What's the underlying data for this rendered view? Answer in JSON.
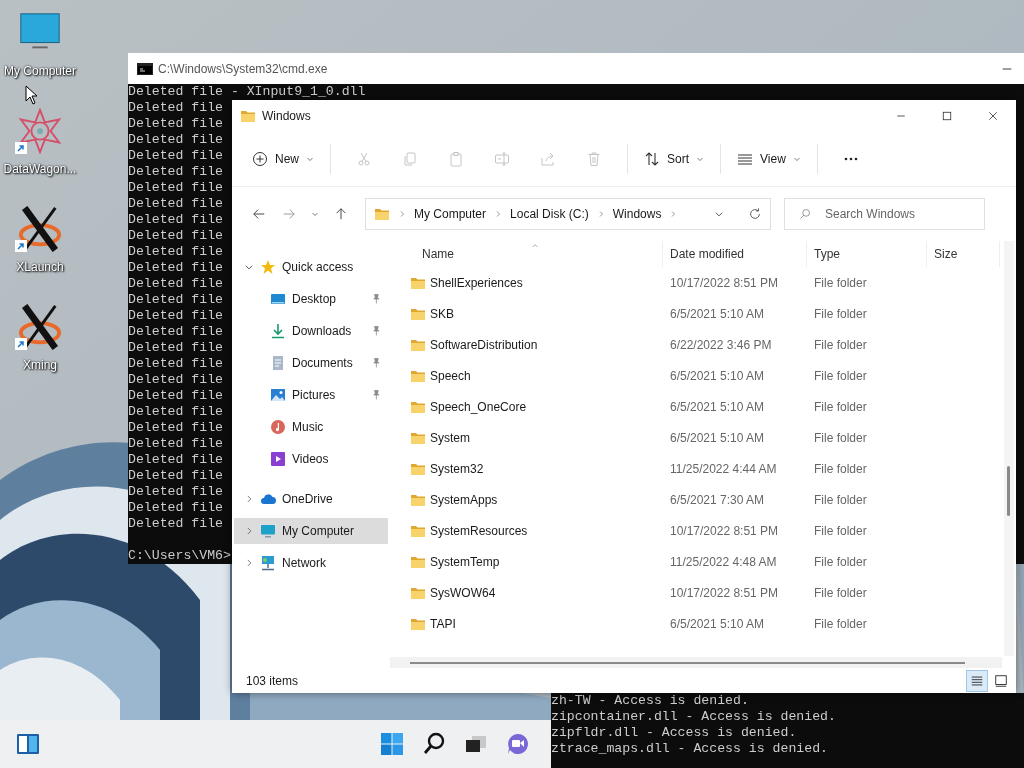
{
  "desktop_icons": [
    {
      "label": "My Computer",
      "shortcut": false
    },
    {
      "label": "DataWagon...",
      "shortcut": true
    },
    {
      "label": "XLaunch",
      "shortcut": true
    },
    {
      "label": "Xming",
      "shortcut": true
    }
  ],
  "console_window": {
    "title": "C:\\Windows\\System32\\cmd.exe",
    "lines": [
      "Deleted file - XInput9_1_0.dll",
      "Deleted file",
      "Deleted file",
      "Deleted file",
      "Deleted file",
      "Deleted file",
      "Deleted file",
      "Deleted file",
      "Deleted file",
      "Deleted file",
      "Deleted file",
      "Deleted file",
      "Deleted file",
      "Deleted file",
      "Deleted file",
      "Deleted file",
      "Deleted file",
      "Deleted file",
      "Deleted file",
      "Deleted file",
      "Deleted file",
      "Deleted file",
      "Deleted file",
      "Deleted file",
      "Deleted file",
      "Deleted file",
      "Deleted file",
      "Deleted file"
    ],
    "prompt": "C:\\Users\\VM6>"
  },
  "background_console": {
    "lines": [
      "zh-TW - Access is denied.",
      "zipcontainer.dll - Access is denied.",
      "zipfldr.dll - Access is denied.",
      "ztrace_maps.dll - Access is denied."
    ]
  },
  "explorer_window": {
    "title": "Windows",
    "toolbar": {
      "new_label": "New",
      "sort_label": "Sort",
      "view_label": "View",
      "actions": [
        {
          "disabled": true
        },
        {
          "disabled": true
        },
        {
          "disabled": true
        },
        {
          "disabled": true
        },
        {
          "disabled": true
        },
        {
          "disabled": true
        }
      ]
    },
    "address": {
      "path": [
        "My Computer",
        "Local Disk (C:)",
        "Windows"
      ]
    },
    "search": {
      "placeholder": "Search Windows"
    },
    "navigation": [
      {
        "label": "Quick access",
        "expanded": true,
        "selected": false,
        "children": [
          {
            "label": "Desktop",
            "pinned": true
          },
          {
            "label": "Downloads",
            "pinned": true
          },
          {
            "label": "Documents",
            "pinned": true
          },
          {
            "label": "Pictures",
            "pinned": true
          },
          {
            "label": "Music",
            "pinned": false
          },
          {
            "label": "Videos",
            "pinned": false
          }
        ]
      },
      {
        "label": "OneDrive",
        "expanded": false,
        "selected": false
      },
      {
        "label": "My Computer",
        "expanded": false,
        "selected": true
      },
      {
        "label": "Network",
        "expanded": false,
        "selected": false
      }
    ],
    "columns": [
      {
        "label": "Name",
        "sorted": true
      },
      {
        "label": "Date modified",
        "sorted": false
      },
      {
        "label": "Type",
        "sorted": false
      },
      {
        "label": "Size",
        "sorted": false
      }
    ],
    "rows": [
      {
        "name": "ShellExperiences",
        "date": "10/17/2022 8:51 PM",
        "type": "File folder"
      },
      {
        "name": "SKB",
        "date": "6/5/2021 5:10 AM",
        "type": "File folder"
      },
      {
        "name": "SoftwareDistribution",
        "date": "6/22/2022 3:46 PM",
        "type": "File folder"
      },
      {
        "name": "Speech",
        "date": "6/5/2021 5:10 AM",
        "type": "File folder"
      },
      {
        "name": "Speech_OneCore",
        "date": "6/5/2021 5:10 AM",
        "type": "File folder"
      },
      {
        "name": "System",
        "date": "6/5/2021 5:10 AM",
        "type": "File folder"
      },
      {
        "name": "System32",
        "date": "11/25/2022 4:44 AM",
        "type": "File folder"
      },
      {
        "name": "SystemApps",
        "date": "6/5/2021 7:30 AM",
        "type": "File folder"
      },
      {
        "name": "SystemResources",
        "date": "10/17/2022 8:51 PM",
        "type": "File folder"
      },
      {
        "name": "SystemTemp",
        "date": "11/25/2022 4:48 AM",
        "type": "File folder"
      },
      {
        "name": "SysWOW64",
        "date": "10/17/2022 8:51 PM",
        "type": "File folder"
      },
      {
        "name": "TAPI",
        "date": "6/5/2021 5:10 AM",
        "type": "File folder"
      }
    ],
    "status_bar": {
      "item_count": "103 items"
    },
    "view_modes": [
      {
        "selected": true
      },
      {
        "selected": false
      }
    ]
  }
}
